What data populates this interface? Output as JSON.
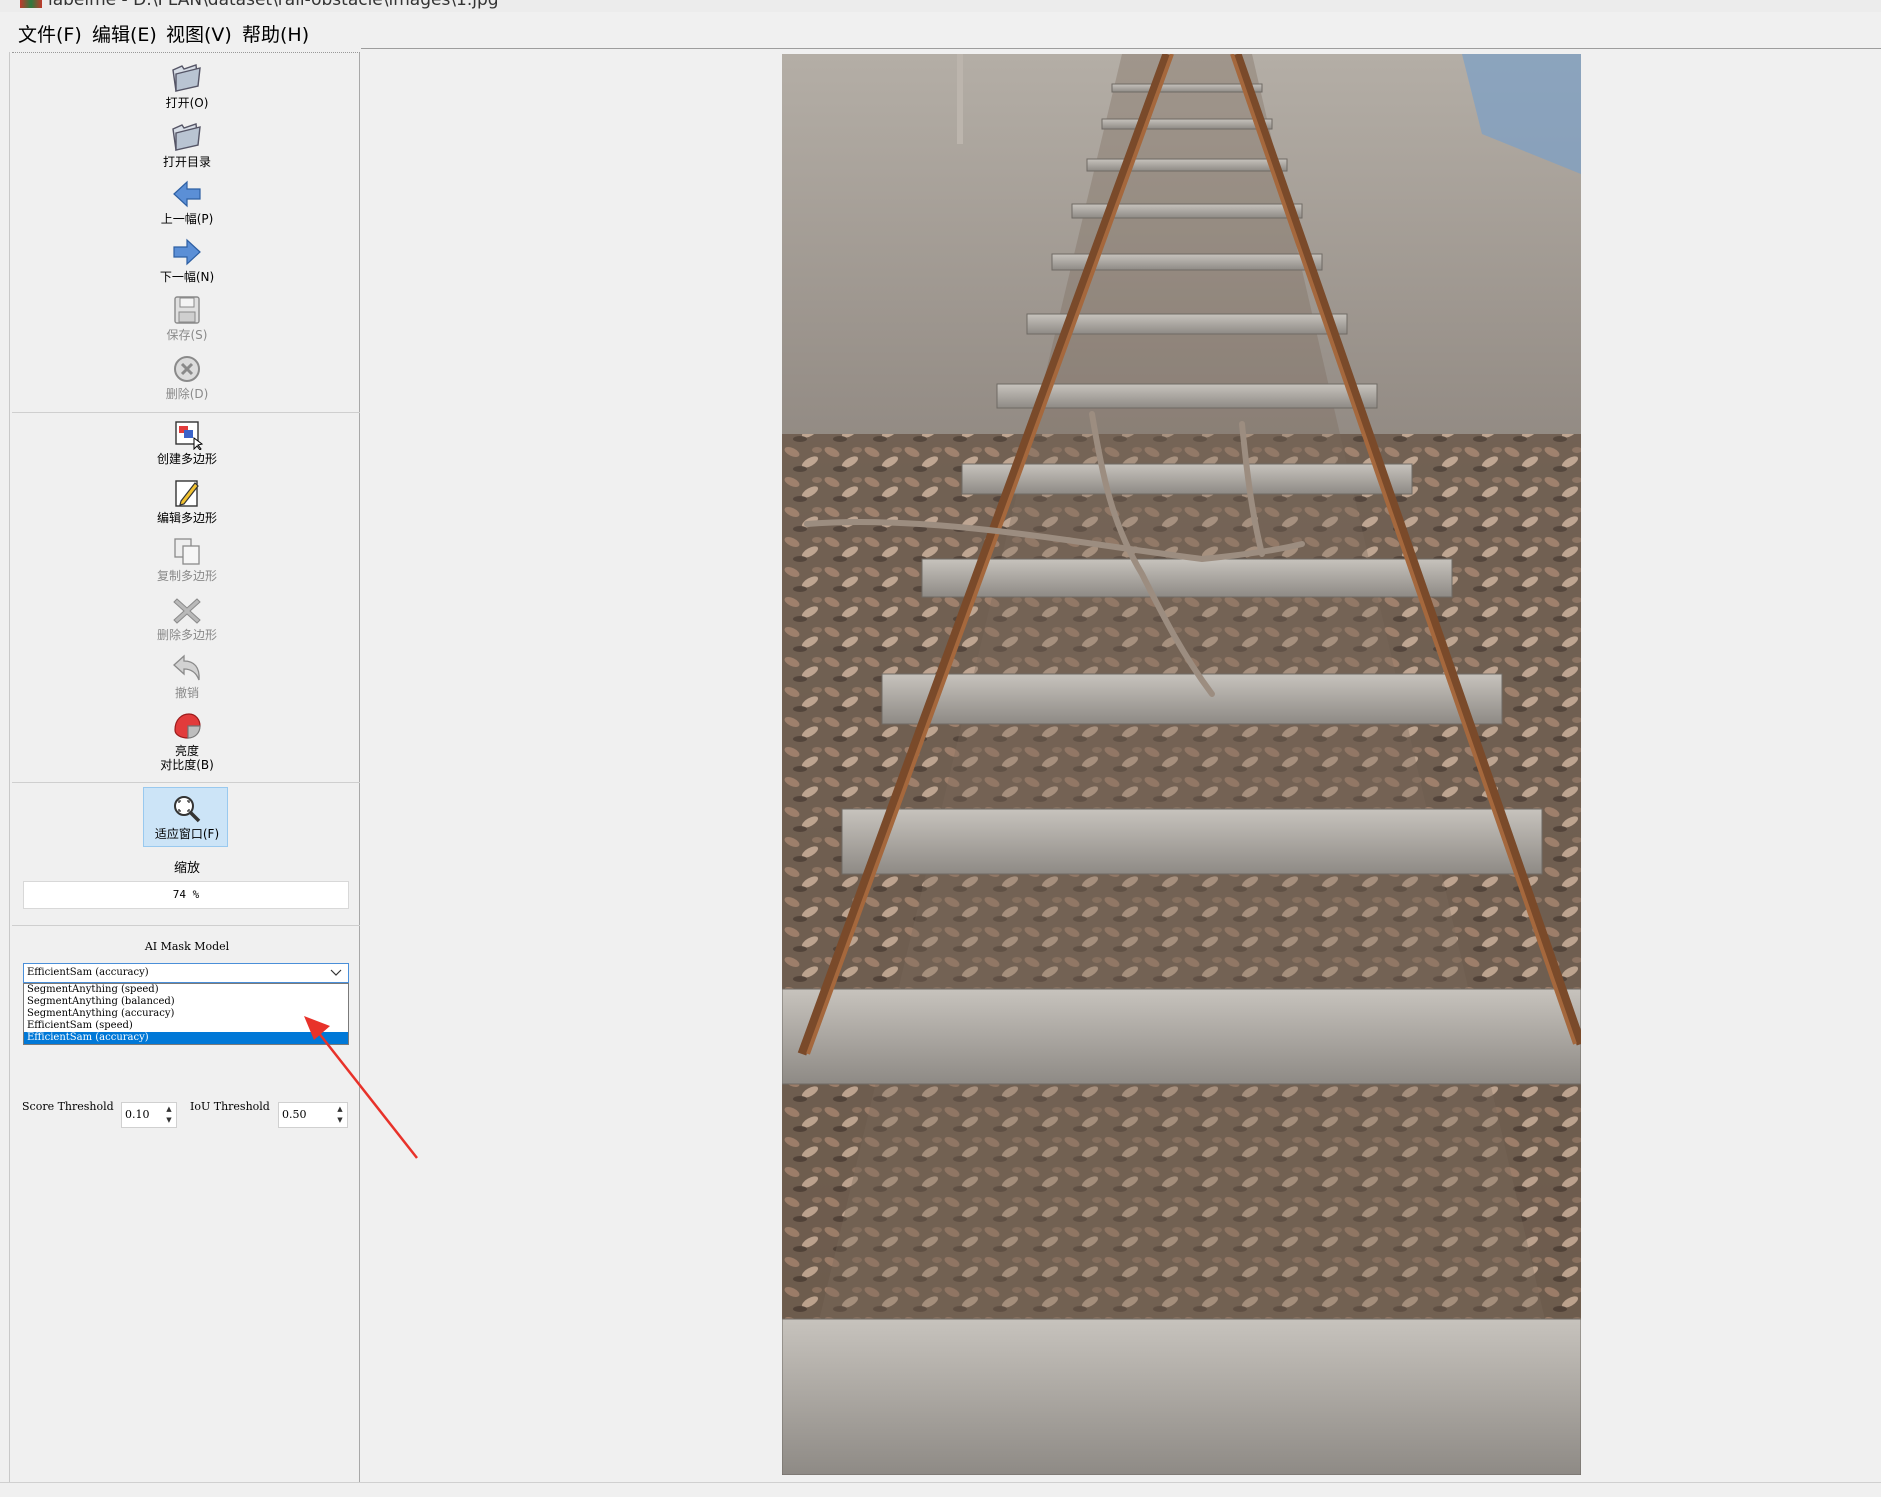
{
  "window": {
    "title": "labelme - D:\\PLAN\\dataset\\rail-obstacle\\images\\1.jpg"
  },
  "menu": [
    "文件(F)",
    "编辑(E)",
    "视图(V)",
    "帮助(H)"
  ],
  "tools": {
    "open": "打开(O)",
    "open_dir": "打开目录",
    "prev": "上一幅(P)",
    "next": "下一幅(N)",
    "save": "保存(S)",
    "delete": "删除(D)",
    "create_polygon": "创建多边形",
    "edit_polygon": "编辑多边形",
    "copy_polygon": "复制多边形",
    "delete_polygon": "删除多边形",
    "undo": "撤销",
    "brightness_line1": "亮度",
    "brightness_line2": "对比度(B)",
    "fit_window": "适应窗口(F)"
  },
  "zoom": {
    "label": "缩放",
    "value": "74 %"
  },
  "ai": {
    "label": "AI Mask Model",
    "selected": "EfficientSam (accuracy)",
    "options": [
      "SegmentAnything (speed)",
      "SegmentAnything (balanced)",
      "SegmentAnything (accuracy)",
      "EfficientSam (speed)",
      "EfficientSam (accuracy)"
    ],
    "score_label": "Score Threshold",
    "score_value": "0.10",
    "iou_label": "IoU Threshold",
    "iou_value": "0.50"
  },
  "colors": {
    "accent": "#0078d7",
    "annotation_arrow": "#e8322a",
    "toolbar_bg": "#f0f0f0",
    "selected_tool": "#cce4f7"
  },
  "icons": [
    "folder-open-icon",
    "folder-icon",
    "arrow-left-icon",
    "arrow-right-icon",
    "save-icon",
    "delete-circle-icon",
    "create-polygon-icon",
    "edit-polygon-icon",
    "copy-icon",
    "delete-x-icon",
    "undo-icon",
    "brightness-icon",
    "zoom-fit-icon"
  ]
}
